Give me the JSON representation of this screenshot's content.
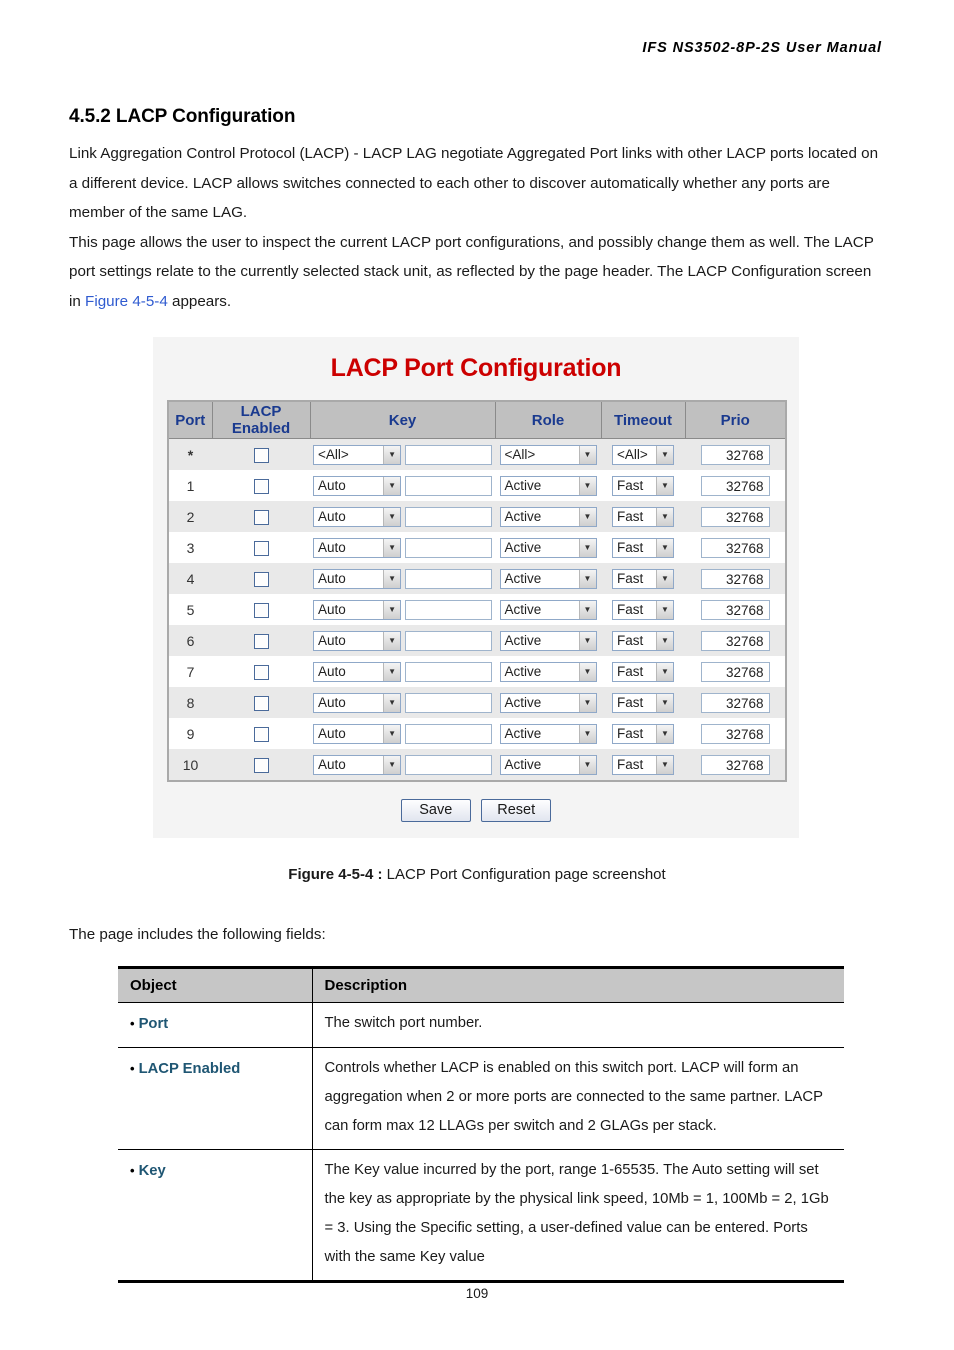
{
  "header": {
    "running_title": "IFS  NS3502-8P-2S  User  Manual"
  },
  "section": {
    "number_title": "4.5.2 LACP Configuration",
    "para1_a": "Link Aggregation Control Protocol (LACP) - LACP LAG negotiate Aggregated Port links with other LACP ports located on a different device. LACP allows switches connected to each other to discover automatically whether any ports are member of the same LAG.",
    "para2_a": "This page allows the user to inspect the current LACP port configurations, and possibly change them as well. The LACP port settings relate to the currently selected stack unit, as reflected by the page header. The LACP Configuration screen in ",
    "para2_link": "Figure 4-5-4",
    "para2_b": " appears."
  },
  "figure": {
    "ui_title": "LACP Port Configuration",
    "columns": [
      "Port",
      "LACP Enabled",
      "Key",
      "Role",
      "Timeout",
      "Prio"
    ],
    "rows": [
      {
        "port": "*",
        "lacp_enabled": false,
        "key_select": "<All>",
        "key_value": "",
        "role": "<All>",
        "timeout": "<All>",
        "prio": "32768"
      },
      {
        "port": "1",
        "lacp_enabled": false,
        "key_select": "Auto",
        "key_value": "",
        "role": "Active",
        "timeout": "Fast",
        "prio": "32768"
      },
      {
        "port": "2",
        "lacp_enabled": false,
        "key_select": "Auto",
        "key_value": "",
        "role": "Active",
        "timeout": "Fast",
        "prio": "32768"
      },
      {
        "port": "3",
        "lacp_enabled": false,
        "key_select": "Auto",
        "key_value": "",
        "role": "Active",
        "timeout": "Fast",
        "prio": "32768"
      },
      {
        "port": "4",
        "lacp_enabled": false,
        "key_select": "Auto",
        "key_value": "",
        "role": "Active",
        "timeout": "Fast",
        "prio": "32768"
      },
      {
        "port": "5",
        "lacp_enabled": false,
        "key_select": "Auto",
        "key_value": "",
        "role": "Active",
        "timeout": "Fast",
        "prio": "32768"
      },
      {
        "port": "6",
        "lacp_enabled": false,
        "key_select": "Auto",
        "key_value": "",
        "role": "Active",
        "timeout": "Fast",
        "prio": "32768"
      },
      {
        "port": "7",
        "lacp_enabled": false,
        "key_select": "Auto",
        "key_value": "",
        "role": "Active",
        "timeout": "Fast",
        "prio": "32768"
      },
      {
        "port": "8",
        "lacp_enabled": false,
        "key_select": "Auto",
        "key_value": "",
        "role": "Active",
        "timeout": "Fast",
        "prio": "32768"
      },
      {
        "port": "9",
        "lacp_enabled": false,
        "key_select": "Auto",
        "key_value": "",
        "role": "Active",
        "timeout": "Fast",
        "prio": "32768"
      },
      {
        "port": "10",
        "lacp_enabled": false,
        "key_select": "Auto",
        "key_value": "",
        "role": "Active",
        "timeout": "Fast",
        "prio": "32768"
      }
    ],
    "save_label": "Save",
    "reset_label": "Reset",
    "dropdown_icon": "chevron-down-icon",
    "title_color": "#cc0000",
    "header_bg": "#c0c0c0",
    "header_text_color": "#1a3a8f"
  },
  "caption": {
    "label": "Figure 4-5-4 :",
    "text": " LACP Port Configuration page screenshot"
  },
  "lead_line": "The page includes the following fields:",
  "desc_table": {
    "headers": [
      "Object",
      "Description"
    ],
    "rows": [
      {
        "object": "Port",
        "description": "The switch port number."
      },
      {
        "object": "LACP Enabled",
        "description": "Controls whether LACP is enabled on this switch port. LACP will form an aggregation when 2 or more ports are connected to the same partner. LACP can form max 12 LLAGs per switch and 2 GLAGs per stack."
      },
      {
        "object": "Key",
        "description": "The Key value incurred by the port, range 1-65535. The Auto setting will set the key as appropriate by the physical link speed, 10Mb = 1, 100Mb = 2, 1Gb = 3. Using the Specific setting, a user-defined value can be entered. Ports with the same Key value"
      }
    ],
    "bullet": "•"
  },
  "page_number": "109"
}
